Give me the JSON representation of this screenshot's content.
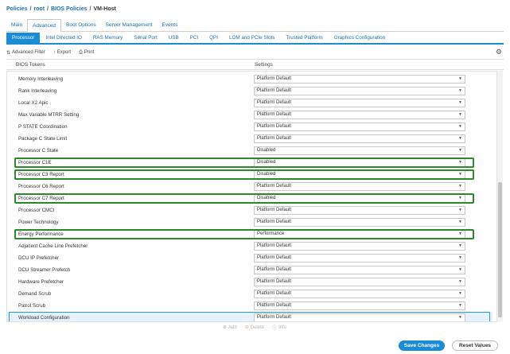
{
  "breadcrumb": [
    "Policies",
    "root",
    "BIOS Policies",
    "VM-Host"
  ],
  "tabs_top": [
    {
      "label": "Main",
      "active": false
    },
    {
      "label": "Advanced",
      "active": true
    },
    {
      "label": "Boot Options",
      "active": false
    },
    {
      "label": "Server Management",
      "active": false
    },
    {
      "label": "Events",
      "active": false
    }
  ],
  "tabs_sub": [
    {
      "label": "Processor",
      "active": true
    },
    {
      "label": "Intel Directed IO",
      "active": false
    },
    {
      "label": "RAS Memory",
      "active": false
    },
    {
      "label": "Serial Port",
      "active": false
    },
    {
      "label": "USB",
      "active": false
    },
    {
      "label": "PCI",
      "active": false
    },
    {
      "label": "QPI",
      "active": false
    },
    {
      "label": "LOM and PCIe Slots",
      "active": false
    },
    {
      "label": "Trusted Platform",
      "active": false
    },
    {
      "label": "Graphics Configuration",
      "active": false
    }
  ],
  "toolbar": {
    "advanced_filter": "Advanced Filter",
    "export": "Export",
    "print": "Print"
  },
  "table": {
    "headers": [
      "BIOS Tokens",
      "Settings"
    ],
    "rows": [
      {
        "token": "Memory Interleaving",
        "value": "Platform Default",
        "highlighted": false,
        "selected": false
      },
      {
        "token": "Rank Interleaving",
        "value": "Platform Default",
        "highlighted": false,
        "selected": false
      },
      {
        "token": "Local X2 Apic",
        "value": "Platform Default",
        "highlighted": false,
        "selected": false
      },
      {
        "token": "Max Variable MTRR Setting",
        "value": "Platform Default",
        "highlighted": false,
        "selected": false
      },
      {
        "token": "P STATE Coordination",
        "value": "Platform Default",
        "highlighted": false,
        "selected": false
      },
      {
        "token": "Package C State Limit",
        "value": "Platform Default",
        "highlighted": false,
        "selected": false
      },
      {
        "token": "Processor C State",
        "value": "Disabled",
        "highlighted": false,
        "selected": false
      },
      {
        "token": "Processor C1E",
        "value": "Disabled",
        "highlighted": true,
        "selected": false
      },
      {
        "token": "Processor C3 Report",
        "value": "Disabled",
        "highlighted": true,
        "selected": false
      },
      {
        "token": "Processor C6 Report",
        "value": "Platform Default",
        "highlighted": false,
        "selected": false
      },
      {
        "token": "Processor C7 Report",
        "value": "Disabled",
        "highlighted": true,
        "selected": false
      },
      {
        "token": "Processor CMCI",
        "value": "Platform Default",
        "highlighted": false,
        "selected": false
      },
      {
        "token": "Power Technology",
        "value": "Platform Default",
        "highlighted": false,
        "selected": false
      },
      {
        "token": "Energy Performance",
        "value": "Performance",
        "highlighted": true,
        "selected": false
      },
      {
        "token": "Adjacent Cache Line Prefetcher",
        "value": "Platform Default",
        "highlighted": false,
        "selected": false
      },
      {
        "token": "DCU IP Prefetcher",
        "value": "Platform Default",
        "highlighted": false,
        "selected": false
      },
      {
        "token": "DCU Streamer Prefetch",
        "value": "Platform Default",
        "highlighted": false,
        "selected": false
      },
      {
        "token": "Hardware Prefetcher",
        "value": "Platform Default",
        "highlighted": false,
        "selected": false
      },
      {
        "token": "Demand Scrub",
        "value": "Platform Default",
        "highlighted": false,
        "selected": false
      },
      {
        "token": "Patrol Scrub",
        "value": "Platform Default",
        "highlighted": false,
        "selected": false
      },
      {
        "token": "Workload Configuration",
        "value": "Platform Default",
        "highlighted": false,
        "selected": true
      }
    ]
  },
  "footer_actions": {
    "add": "Add",
    "delete": "Delete",
    "info": "Info"
  },
  "buttons": {
    "save": "Save Changes",
    "reset": "Reset Values"
  },
  "colors": {
    "accent": "#1a8bd6",
    "highlight": "#2a8a2a",
    "link": "#1a6fb3"
  }
}
